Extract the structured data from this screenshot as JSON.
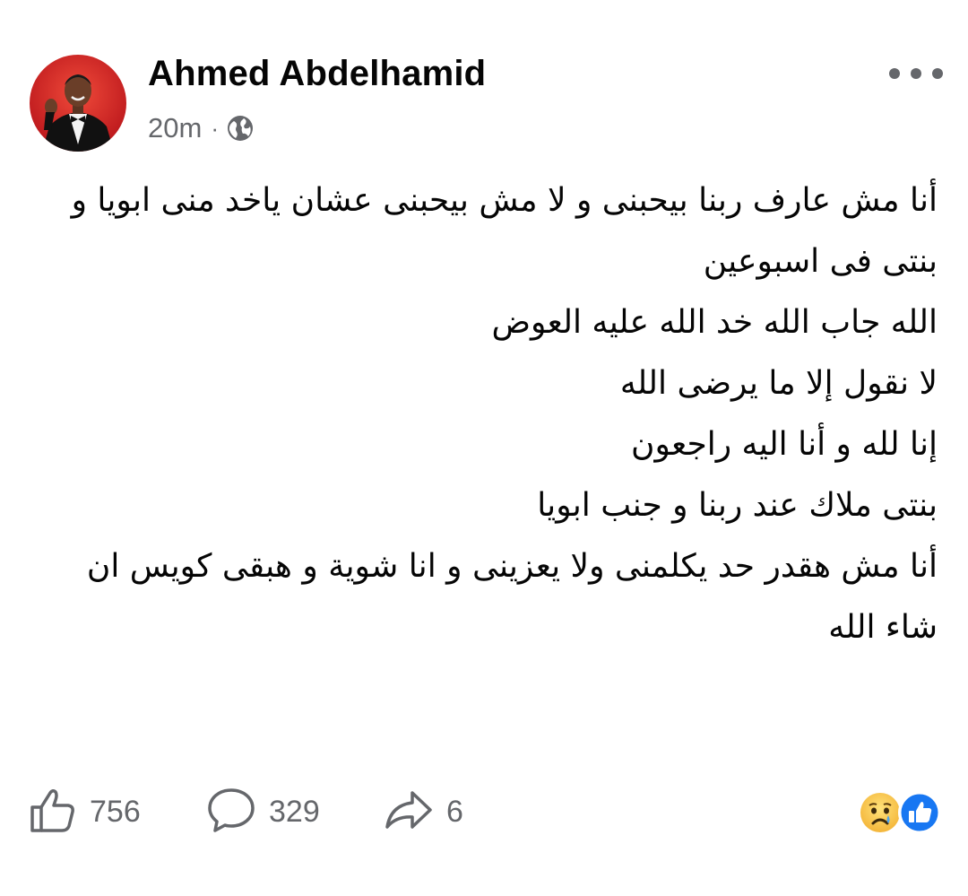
{
  "post": {
    "author_name": "Ahmed Abdelhamid",
    "timestamp": "20m",
    "separator": "·",
    "audience_icon": "globe-icon",
    "more_icon": "more-horizontal-icon",
    "body_lines": [
      "أنا مش عارف ربنا بيحبنى و لا مش بيحبنى عشان ياخد منى ابويا و بنتى فى اسبوعين",
      "الله جاب الله خد الله عليه العوض",
      "لا نقول إلا ما يرضى الله",
      "إنا لله و أنا اليه راجعون",
      "بنتى ملاك عند ربنا و جنب ابويا",
      "أنا مش هقدر حد يكلمنى ولا يعزينى و انا شوية و هبقى كويس ان شاء الله"
    ]
  },
  "footer": {
    "like_count": "756",
    "comment_count": "329",
    "share_count": "6",
    "like_icon": "thumbs-up-icon",
    "comment_icon": "comment-bubble-icon",
    "share_icon": "share-arrow-icon",
    "reactions": [
      "sad-face-reaction-icon",
      "like-reaction-icon"
    ]
  },
  "colors": {
    "text_primary": "#050505",
    "text_secondary": "#65676b",
    "like_blue": "#1877f2",
    "avatar_background": "#d9262a"
  }
}
